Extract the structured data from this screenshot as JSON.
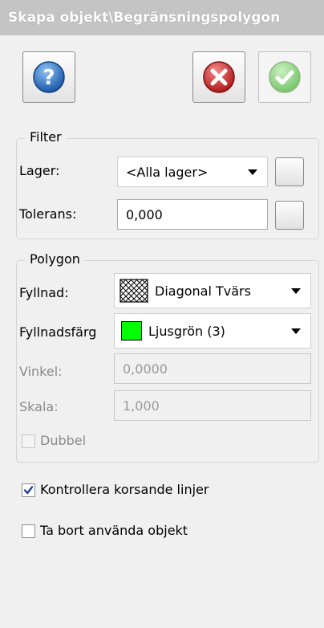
{
  "window": {
    "title": "Skapa objekt\\Begränsningspolygon"
  },
  "toolbar": {
    "help": {
      "icon": "help-icon",
      "color": "#2a6fc0"
    },
    "cancel": {
      "icon": "close-icon",
      "color": "#c8282b"
    },
    "ok": {
      "icon": "check-icon",
      "color": "#57b848"
    }
  },
  "filter": {
    "title": "Filter",
    "layer_label": "Lager:",
    "layer_value": "<Alla lager>",
    "tolerance_label": "Tolerans:",
    "tolerance_value": "0,000"
  },
  "polygon": {
    "title": "Polygon",
    "fill_label": "Fyllnad:",
    "fill_value": "Diagonal Tvärs",
    "fill_color_label": "Fyllnadsfärg",
    "fill_color_value": "Ljusgrön (3)",
    "fill_color_swatch": "#00ff00",
    "angle_label": "Vinkel:",
    "angle_value": "0,0000",
    "scale_label": "Skala:",
    "scale_value": "1,000",
    "double_label": "Dubbel",
    "double_checked": false
  },
  "options": {
    "check_crossing_label": "Kontrollera korsande linjer",
    "check_crossing_checked": true,
    "remove_used_label": "Ta bort använda objekt",
    "remove_used_checked": false
  }
}
